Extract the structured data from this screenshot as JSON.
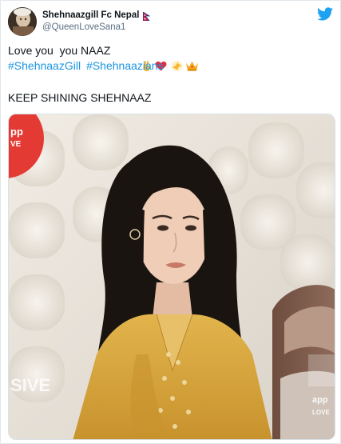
{
  "author": {
    "display_name": "Shehnaazgill Fc Nepal",
    "handle": "@QueenLoveSana1"
  },
  "tweet": {
    "line1_text": "Love you  you NAAZ",
    "emojis": [
      "victory-hand-emoji",
      "red-heart-emoji",
      "sparkle-emoji",
      "crown-emoji"
    ],
    "hashtags": [
      "#ShehnaazGill",
      "#Shehnaazians"
    ],
    "line3_text": "KEEP SHINING SHEHNAAZ"
  },
  "media": {
    "overlay_left_top": "pp\nVE",
    "overlay_left_bottom": "SIVE",
    "overlay_right_bottom": "app\nLOVE"
  },
  "colors": {
    "twitter_blue": "#1da1f2",
    "hashtag_blue": "#1b95e0",
    "text": "#0f1419",
    "secondary": "#5b7083",
    "dress_yellow": "#d9a93b"
  },
  "icons": [
    "twitter-bird-icon",
    "nepal-flag-icon"
  ]
}
